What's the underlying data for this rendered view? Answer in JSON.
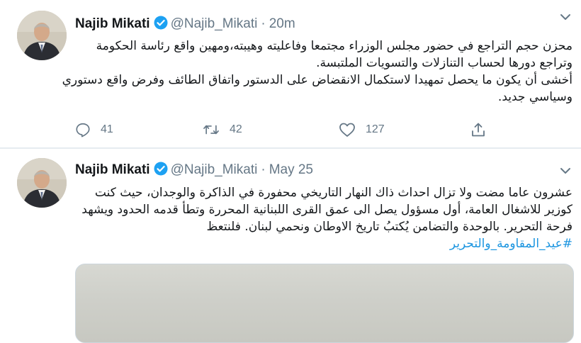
{
  "tweets": [
    {
      "author_name": "Najib Mikati",
      "handle": "@Najib_Mikati",
      "separator": "·",
      "time": "20m",
      "body_lines": [
        "محزن حجم التراجع في حضور مجلس الوزراء مجتمعا وفاعليته وهيبته،ومهين واقع رئاسة الحكومة",
        "وتراجع دورها لحساب التنازلات والتسويات الملتبسة.",
        "أخشى أن يكون ما يحصل تمهيدا لاستكمال الانقضاض على الدستور واتفاق الطائف وفرض واقع دستوري",
        "وسياسي جديد."
      ],
      "actions": {
        "replies": "41",
        "retweets": "42",
        "likes": "127"
      }
    },
    {
      "author_name": "Najib Mikati",
      "handle": "@Najib_Mikati",
      "separator": "·",
      "time": "May 25",
      "body_lines": [
        "عشرون عاما مضت ولا تزال احداث ذاك النهار التاريخي محفورة في الذاكرة والوجدان، حيث كنت",
        "كوزير للاشغال العامة، أول مسؤول يصل الى عمق القرى اللبنانية المحررة وتطأ قدمه الحدود ويشهد",
        "فرحة التحرير. بالوحدة والتضامن يُكتبُ تاريخ الاوطان ونحمي لبنان. فلنتعظ"
      ],
      "hashtag": "#عيد_المقاومة_والتحرير"
    }
  ],
  "colors": {
    "verified": "#1da1f2",
    "hashtag": "#1b95e0",
    "secondary_text": "#657786"
  },
  "icons": [
    "verified-badge-icon",
    "chevron-down-icon",
    "reply-icon",
    "retweet-icon",
    "like-icon",
    "share-icon"
  ]
}
